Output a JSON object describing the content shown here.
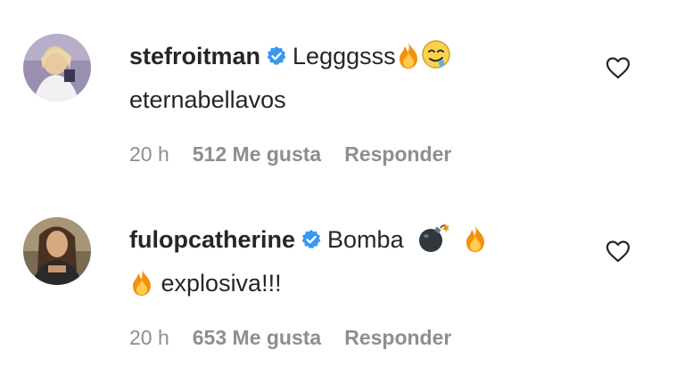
{
  "comments": [
    {
      "username": "stefroitman",
      "text_line1": "Legggsss",
      "text_line2": "eternabellavos",
      "time": "20 h",
      "likes": "512 Me gusta",
      "reply": "Responder",
      "verified_icon": "verified-badge-icon",
      "emojis": [
        "fire-emoji",
        "drooling-face-emoji"
      ],
      "liked": false
    },
    {
      "username": "fulopcatherine",
      "text_line1": "Bomba",
      "text_line2": "explosiva!!!",
      "time": "20 h",
      "likes": "653 Me gusta",
      "reply": "Responder",
      "verified_icon": "verified-badge-icon",
      "emojis": [
        "bomb-emoji",
        "fire-emoji",
        "fire-emoji"
      ],
      "liked": false
    }
  ],
  "colors": {
    "text": "#262626",
    "meta": "#8e8e8e",
    "verified": "#3897f0",
    "background": "#ffffff"
  }
}
